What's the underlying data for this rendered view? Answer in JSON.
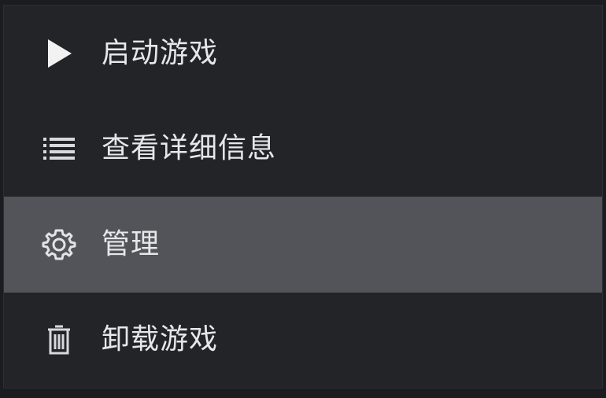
{
  "menu": {
    "items": [
      {
        "label": "启动游戏",
        "icon": "play-icon"
      },
      {
        "label": "查看详细信息",
        "icon": "list-icon"
      },
      {
        "label": "管理",
        "icon": "gear-icon",
        "active": true
      },
      {
        "label": "卸载游戏",
        "icon": "trash-icon"
      }
    ]
  },
  "colors": {
    "background": "#232428",
    "active_background": "#535459",
    "text": "#e6e7ea"
  }
}
